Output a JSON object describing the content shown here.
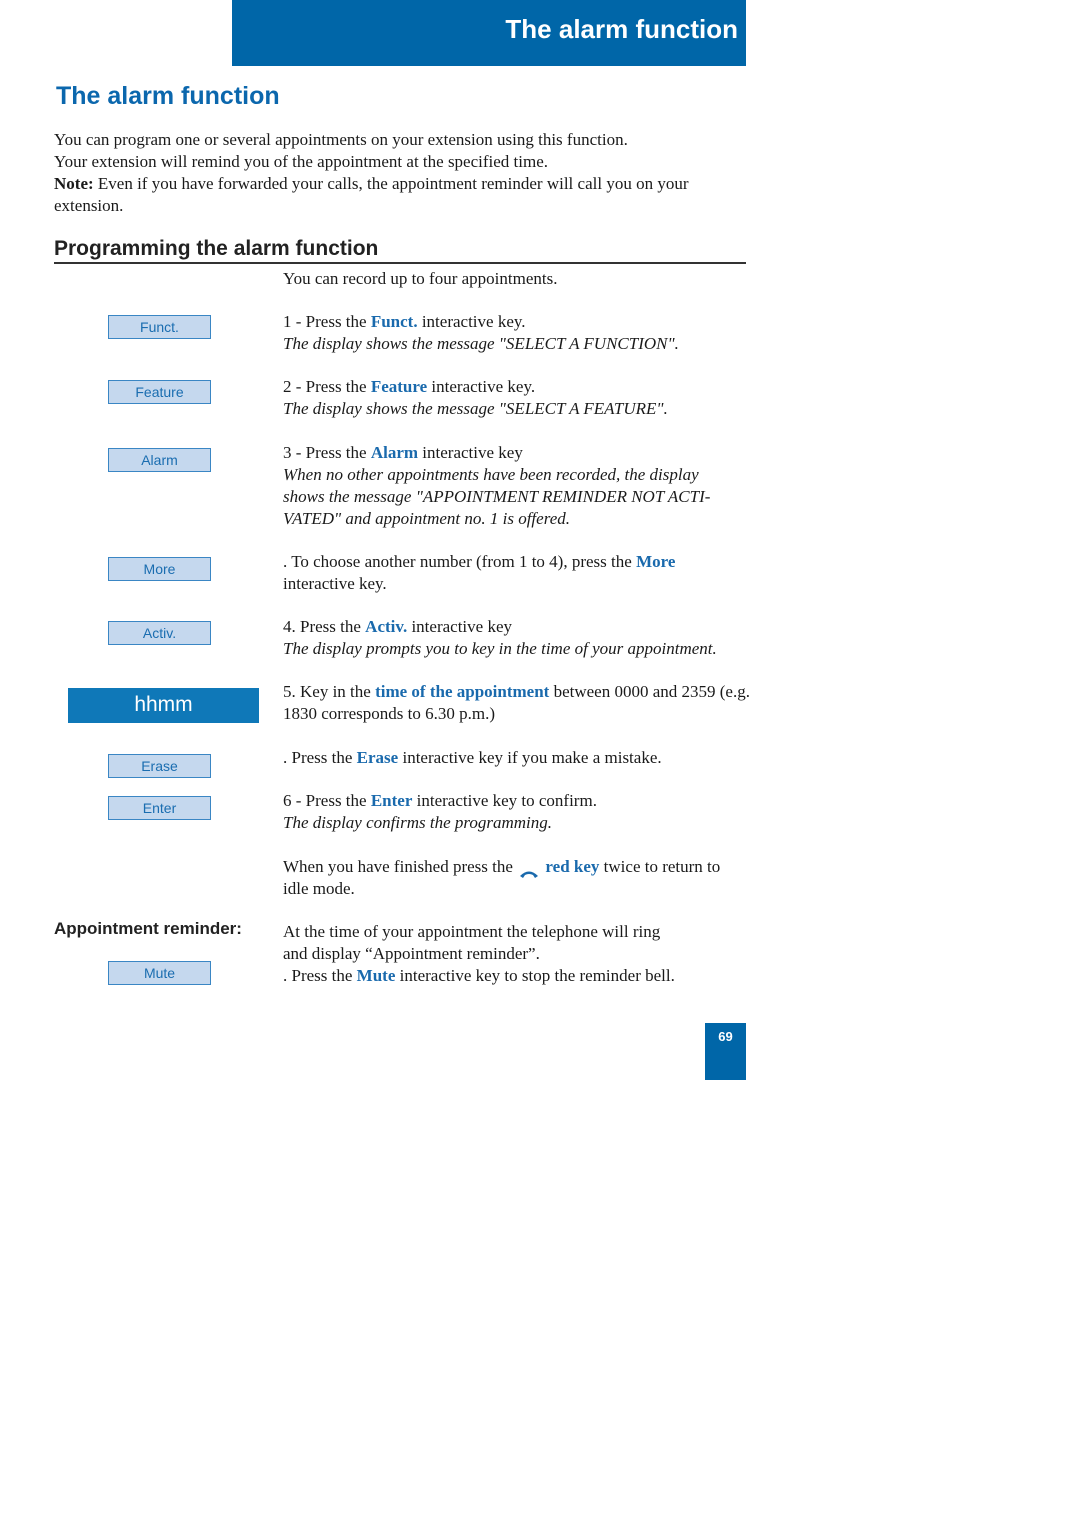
{
  "header": {
    "title": "The alarm function"
  },
  "page_title": "The alarm function",
  "intro": {
    "line1": "You can program one or several appointments on your extension using this function.",
    "line2": "Your extension will remind you of the appointment at the specified time.",
    "note_label": "Note:",
    "note_text": " Even if you have forwarded your calls, the appointment reminder will call you on your extension."
  },
  "section": {
    "heading": "Programming the alarm function"
  },
  "keys": {
    "funct": "Funct.",
    "feature": "Feature",
    "alarm": "Alarm",
    "more": "More",
    "activ": "Activ.",
    "erase": "Erase",
    "enter": "Enter",
    "mute": "Mute"
  },
  "display": {
    "hhmm": "hhmm"
  },
  "appointment_reminder_label": "Appointment reminder:",
  "steps": {
    "record": "You can record up to four appointments.",
    "s1": {
      "pre": "1 - Press the ",
      "key": "Funct.",
      "post": " interactive key.",
      "note": "The display shows the message \"SELECT A FUNCTION\"."
    },
    "s2": {
      "pre": "2 - Press the ",
      "key": "Feature",
      "post": " interactive key.",
      "note": "The display shows the message \"SELECT A FEATURE\"."
    },
    "s3": {
      "pre": "3 - Press the ",
      "key": "Alarm",
      "post": " interactive key",
      "note": "When no other appointments have been recorded, the display shows the message \"APPOINTMENT REMINDER NOT ACTI-VATED\" and appointment no. 1 is offered."
    },
    "more": {
      "pre": ". To choose another number (from 1 to 4), press the ",
      "key": "More",
      "post": " interactive key."
    },
    "s4": {
      "pre": "4. Press the ",
      "key": "Activ.",
      "post": " interactive key",
      "note": "The display prompts you to key in the time of your appointment."
    },
    "s5": {
      "pre": "5. Key in the ",
      "key": "time of the appointment",
      "post": " between 0000 and 2359 (e.g. 1830 corresponds to 6.30 p.m.)"
    },
    "erase": {
      "pre": ". Press the ",
      "key": "Erase",
      "post": " interactive key if you make a mistake."
    },
    "s6": {
      "pre": "6 - Press the ",
      "key": "Enter",
      "post": " interactive key to confirm.",
      "note": "The display confirms the programming."
    },
    "finish": {
      "pre": "When you have finished press the ",
      "key": "red key",
      "post": " twice to return to idle mode."
    },
    "reminder": {
      "line1": "At the time of your appointment the telephone will ring",
      "line2": "and display “Appointment reminder”.",
      "pre": ". Press the ",
      "key": "Mute",
      "post": " interactive key to stop the reminder bell."
    }
  },
  "page_number": "69",
  "colors": {
    "brand_blue": "#0066a8",
    "key_fill": "#c5d8ee",
    "highlight": "#1a6aad"
  }
}
